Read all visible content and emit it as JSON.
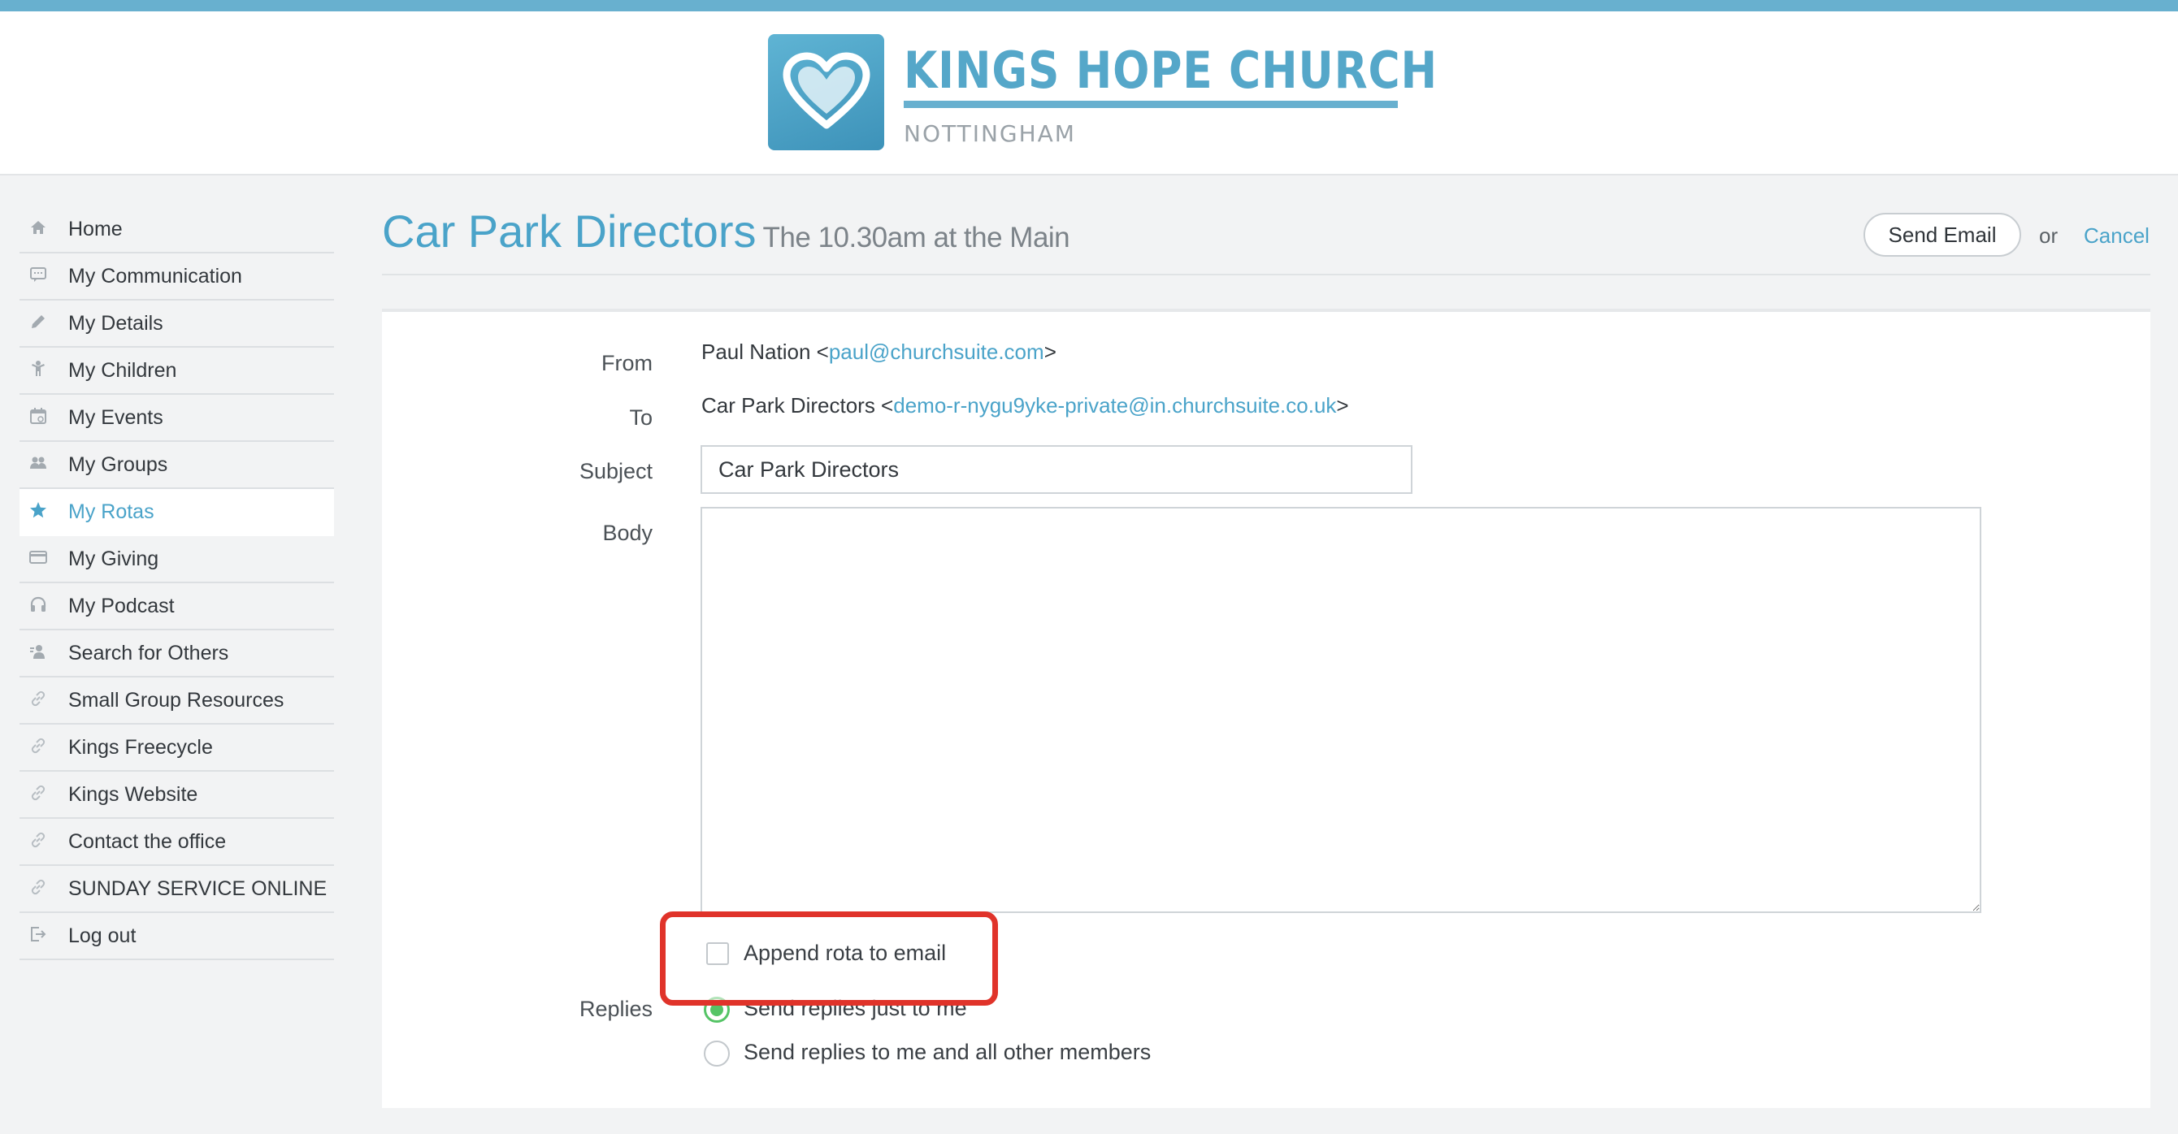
{
  "brand": {
    "name": "KINGS HOPE CHURCH",
    "location": "NOTTINGHAM",
    "accent": "#4aa3c9",
    "topbar_color": "#68b0cf"
  },
  "sidebar": {
    "items": [
      {
        "label": "Home",
        "icon": "home-icon",
        "active": false
      },
      {
        "label": "My Communication",
        "icon": "chat-icon",
        "active": false
      },
      {
        "label": "My Details",
        "icon": "pencil-icon",
        "active": false
      },
      {
        "label": "My Children",
        "icon": "child-icon",
        "active": false
      },
      {
        "label": "My Events",
        "icon": "calendar-icon",
        "active": false
      },
      {
        "label": "My Groups",
        "icon": "group-icon",
        "active": false
      },
      {
        "label": "My Rotas",
        "icon": "star-icon",
        "active": true
      },
      {
        "label": "My Giving",
        "icon": "card-icon",
        "active": false
      },
      {
        "label": "My Podcast",
        "icon": "headphones-icon",
        "active": false
      },
      {
        "label": "Search for Others",
        "icon": "people-search-icon",
        "active": false
      },
      {
        "label": "Small Group Resources",
        "icon": "link-icon",
        "active": false
      },
      {
        "label": "Kings Freecycle",
        "icon": "link-icon",
        "active": false
      },
      {
        "label": "Kings Website",
        "icon": "link-icon",
        "active": false
      },
      {
        "label": "Contact the office",
        "icon": "link-icon",
        "active": false
      },
      {
        "label": "SUNDAY SERVICE ONLINE",
        "icon": "link-icon",
        "active": false
      },
      {
        "label": "Log out",
        "icon": "logout-icon",
        "active": false
      }
    ]
  },
  "page": {
    "title": "Car Park Directors",
    "subtitle": "The 10.30am at the Main",
    "send_label": "Send Email",
    "or_text": "or",
    "cancel_label": "Cancel"
  },
  "form": {
    "from_label": "From",
    "from_name": "Paul Nation <",
    "from_email": "paul@churchsuite.com",
    "from_close": ">",
    "to_label": "To",
    "to_name": "Car Park Directors <",
    "to_email": "demo-r-nygu9yke-private@in.churchsuite.co.uk",
    "to_close": ">",
    "subject_label": "Subject",
    "subject_value": "Car Park Directors",
    "body_label": "Body",
    "body_value": "",
    "append_label": "Append rota to email",
    "append_checked": false,
    "replies_label": "Replies",
    "reply_options": [
      {
        "label": "Send replies just to me",
        "checked": true
      },
      {
        "label": "Send replies to me and all other members",
        "checked": false
      }
    ]
  },
  "annotation": {
    "highlight_color": "#e0332a"
  }
}
